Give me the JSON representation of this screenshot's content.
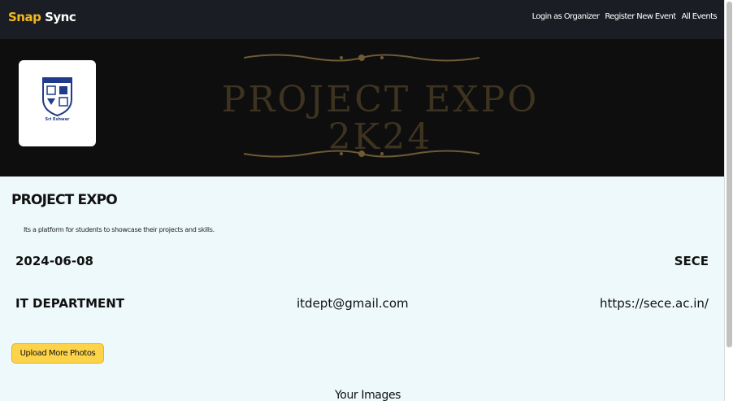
{
  "navbar": {
    "brand_first": "Snap",
    "brand_second": "Sync",
    "links": [
      "Login as Organizer",
      "Register New Event",
      "All Events"
    ]
  },
  "banner": {
    "title_line1": "PROJECT EXPO",
    "title_line2": "2K24",
    "logo_text": "Sri Eshwar"
  },
  "event": {
    "name": "PROJECT EXPO",
    "description": "Its a platform for students to showcase their projects and skills.",
    "date": "2024-06-08",
    "organization": "SECE",
    "department": "IT DEPARTMENT",
    "email": "itdept@gmail.com",
    "website": "https://sece.ac.in/"
  },
  "actions": {
    "upload_label": "Upload More Photos"
  },
  "gallery": {
    "heading": "Your Images"
  },
  "colors": {
    "navbar_bg": "#1a1d24",
    "brand_accent": "#f2b81f",
    "button_bg": "#fdd34a",
    "page_bg": "#eef9fb"
  }
}
